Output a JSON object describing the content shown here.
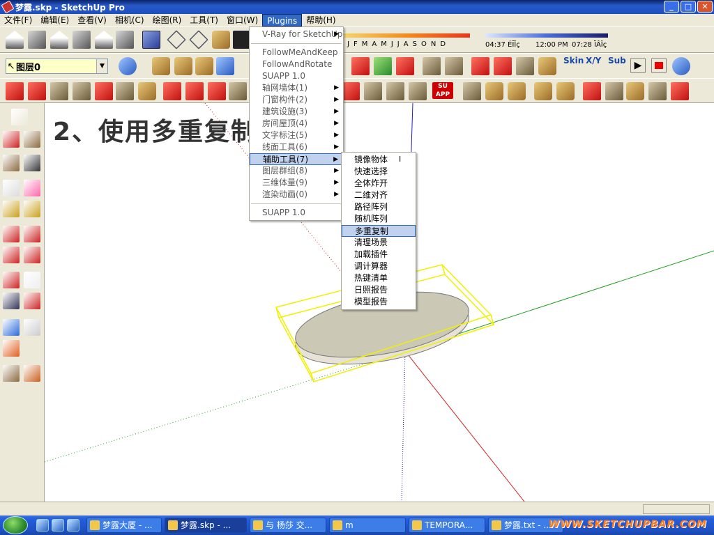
{
  "window": {
    "title": "梦露.skp - SketchUp Pro"
  },
  "window_buttons": [
    "_",
    "□",
    "✕"
  ],
  "menubar": [
    {
      "label": "文件(F)",
      "active": false
    },
    {
      "label": "编辑(E)",
      "active": false
    },
    {
      "label": "查看(V)",
      "active": false
    },
    {
      "label": "相机(C)",
      "active": false
    },
    {
      "label": "绘图(R)",
      "active": false
    },
    {
      "label": "工具(T)",
      "active": false
    },
    {
      "label": "窗口(W)",
      "active": false
    },
    {
      "label": "Plugins",
      "active": true
    },
    {
      "label": "帮助(H)",
      "active": false
    }
  ],
  "layer_select": {
    "value": "图层0"
  },
  "shadow": {
    "months": [
      "J",
      "F",
      "M",
      "A",
      "M",
      "J",
      "J",
      "A",
      "S",
      "O",
      "N",
      "D"
    ],
    "time_start": "04:37 ÉÏÎç",
    "time_noon": "12:00 PM",
    "time_end": "07:28 ÏÂÎç"
  },
  "toolbar_labels": {
    "skin": "Skin",
    "xyz": "X/Y",
    "sub": "Sub",
    "su_app": "SU APP"
  },
  "canvas": {
    "overlay_title": "2、使用多重复制"
  },
  "colors": {
    "selection": "#f0f000",
    "model_fill": "#ccc8b6",
    "axis_red": "#d02020",
    "axis_green": "#20a020",
    "axis_blue": "#2020c0"
  },
  "plugins_menu": {
    "top": [
      "V-Ray for SketchUp"
    ],
    "plain": [
      "FollowMeAndKeep",
      "FollowAndRotate",
      "SUAPP 1.0"
    ],
    "submenus": [
      {
        "label": "轴网墙体(1)",
        "highlighted": false
      },
      {
        "label": "门窗构件(2)",
        "highlighted": false
      },
      {
        "label": "建筑设施(3)",
        "highlighted": false
      },
      {
        "label": "房间屋顶(4)",
        "highlighted": false
      },
      {
        "label": "文字标注(5)",
        "highlighted": false
      },
      {
        "label": "线面工具(6)",
        "highlighted": false
      },
      {
        "label": "辅助工具(7)",
        "highlighted": true
      },
      {
        "label": "图层群组(8)",
        "highlighted": false
      },
      {
        "label": "三维体量(9)",
        "highlighted": false
      },
      {
        "label": "渲染动画(0)",
        "highlighted": false
      }
    ],
    "bottom": [
      "SUAPP 1.0"
    ],
    "submenu_arrow": "▶"
  },
  "aux_tools_menu": [
    {
      "label": "镜像物体",
      "highlighted": false
    },
    {
      "label": "快速选择",
      "highlighted": false
    },
    {
      "label": "全体炸开",
      "highlighted": false
    },
    {
      "label": "二维对齐",
      "highlighted": false
    },
    {
      "label": "路径阵列",
      "highlighted": false
    },
    {
      "label": "随机阵列",
      "highlighted": false
    },
    {
      "label": "多重复制",
      "highlighted": true
    },
    {
      "label": "清理场景",
      "highlighted": false
    },
    {
      "label": "加载插件",
      "highlighted": false
    },
    {
      "label": "调计算器",
      "highlighted": false
    },
    {
      "label": "热键清单",
      "highlighted": false
    },
    {
      "label": "日照报告",
      "highlighted": false
    },
    {
      "label": "模型报告",
      "highlighted": false
    }
  ],
  "taskbar": {
    "tasks": [
      {
        "label": "梦露大厦 - ...",
        "active": false
      },
      {
        "label": "梦露.skp - ...",
        "active": true
      },
      {
        "label": "与 杨莎 交...",
        "active": false
      },
      {
        "label": "m",
        "active": false
      },
      {
        "label": "TEMPORA...",
        "active": false
      },
      {
        "label": "梦露.txt - ...",
        "active": false
      }
    ],
    "watermark": "WWW.SKETCHUPBAR.COM"
  }
}
